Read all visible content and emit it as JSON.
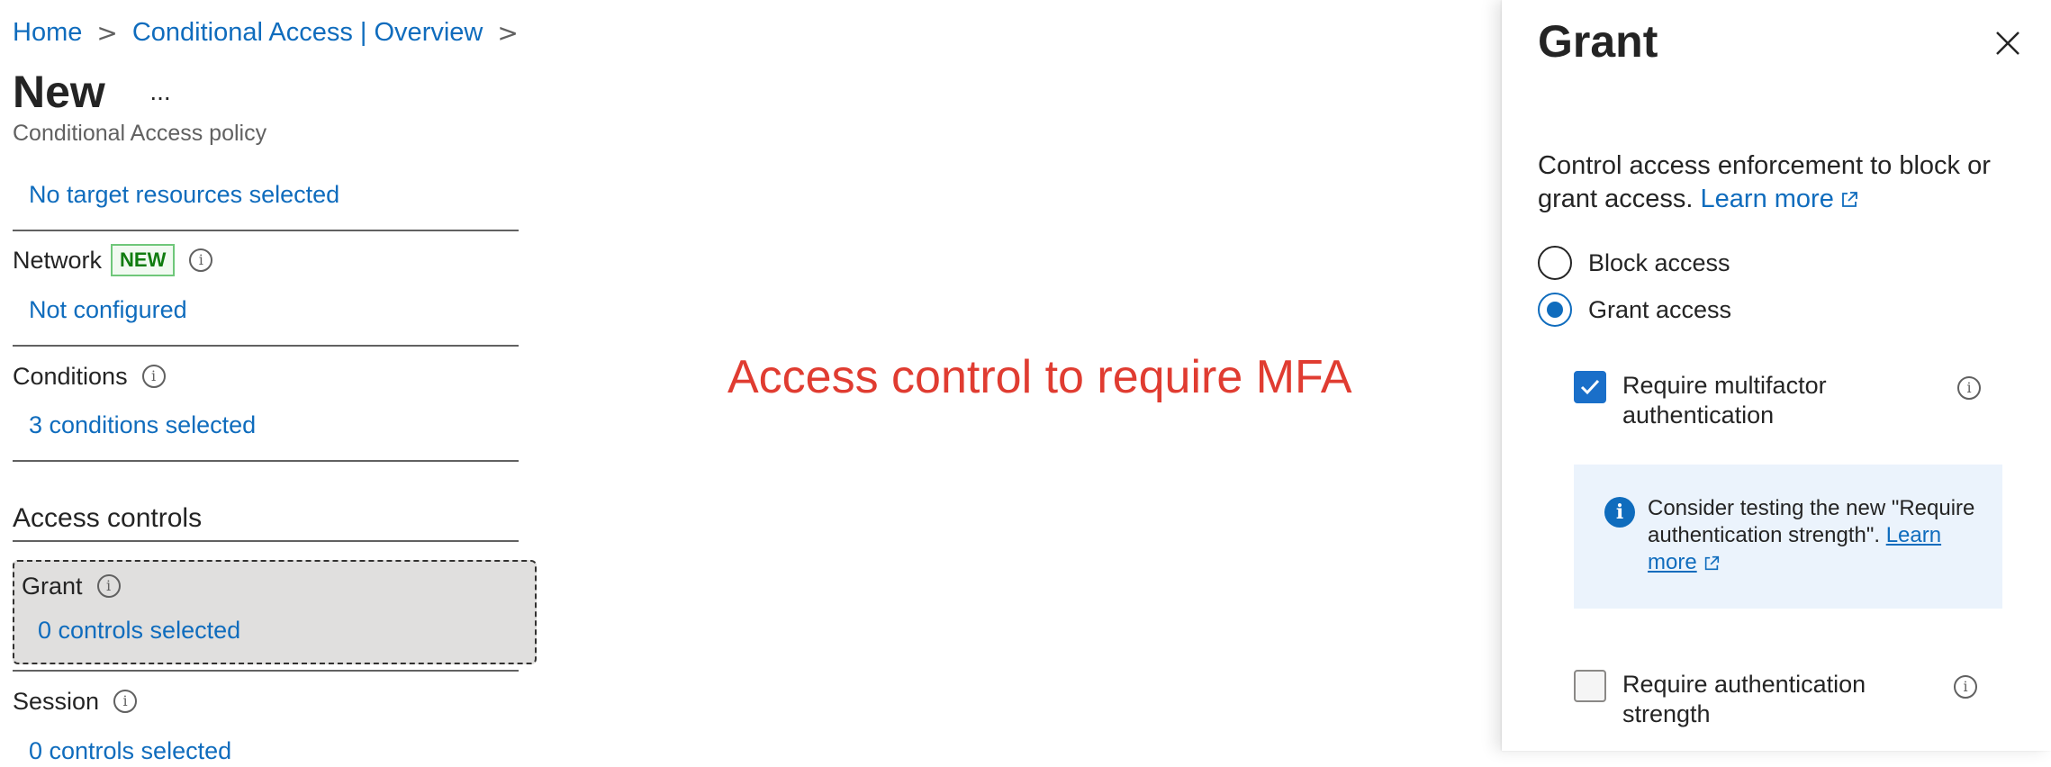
{
  "breadcrumb": {
    "home": "Home",
    "overview": "Conditional Access | Overview",
    "separator": ">"
  },
  "page": {
    "title": "New",
    "more": "...",
    "subtitle": "Conditional Access policy"
  },
  "target_resources": {
    "value": "No target resources selected"
  },
  "network": {
    "label": "Network",
    "badge": "NEW",
    "value": "Not configured"
  },
  "conditions": {
    "label": "Conditions",
    "value": "3 conditions selected"
  },
  "access_controls": {
    "heading": "Access controls",
    "grant": {
      "label": "Grant",
      "value": "0 controls selected"
    },
    "session": {
      "label": "Session",
      "value": "0 controls selected"
    }
  },
  "annotation": "Access control to require MFA",
  "panel": {
    "title": "Grant",
    "description": "Control access enforcement to block or grant access.",
    "learn_more": "Learn more",
    "options": [
      {
        "label": "Block access",
        "selected": false
      },
      {
        "label": "Grant access",
        "selected": true
      }
    ],
    "controls": [
      {
        "label": "Require multifactor authentication",
        "checked": true
      },
      {
        "label": "Require authentication strength",
        "checked": false
      }
    ],
    "info_box": {
      "text": "Consider testing the new \"Require authentication strength\".",
      "link": "Learn more"
    }
  },
  "colors": {
    "link": "#0f6cbd",
    "annotation": "#e03c31",
    "badge_text": "#107c10",
    "info_box_bg": "#ebf3fc",
    "selected_row_bg": "#e0dfde"
  }
}
